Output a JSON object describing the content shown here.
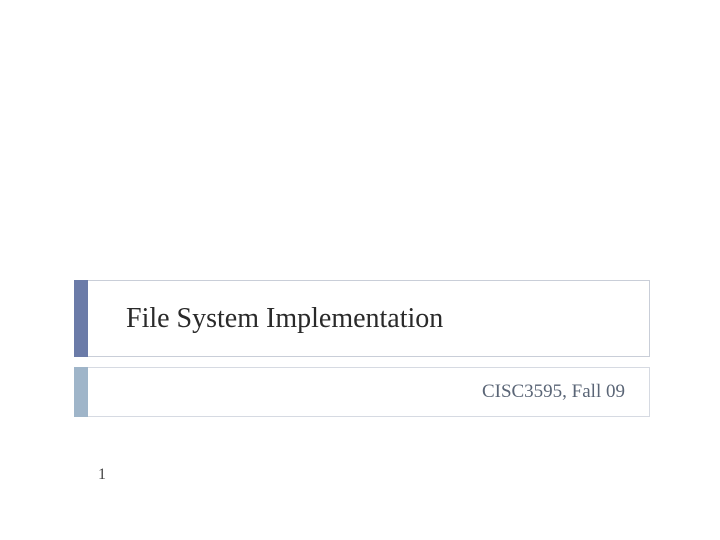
{
  "slide": {
    "title": "File System Implementation",
    "subtitle": "CISC3595, Fall 09",
    "page_number": "1"
  },
  "colors": {
    "title_accent": "#6b7ba8",
    "subtitle_accent": "#9fb5c9",
    "border": "#c9ced8"
  }
}
